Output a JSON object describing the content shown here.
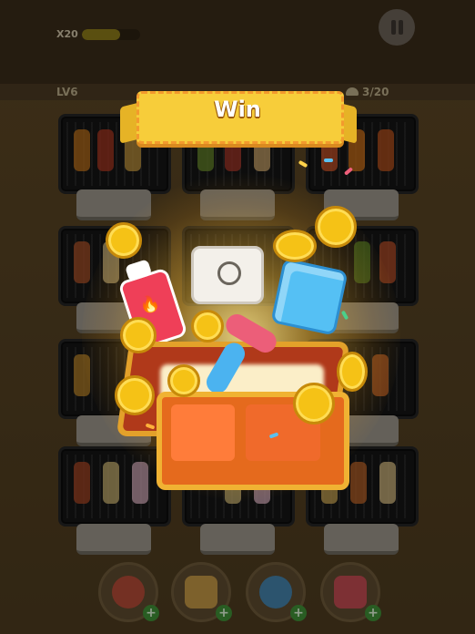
{
  "header": {
    "multiplier": "X20",
    "coin_progress": 0.65,
    "level": "LV6",
    "orders_progress": "3/20"
  },
  "banner": {
    "title": "Win"
  },
  "reward": {
    "items": [
      "takeout-box",
      "ice-cube",
      "fire-spray",
      "swap-arrows",
      "gold-coins"
    ]
  },
  "toolbar": {
    "tools": [
      {
        "name": "shuffle-tool",
        "icon": "refresh-arrows-icon",
        "plus": "+"
      },
      {
        "name": "bag-tool",
        "icon": "takeaway-bag-icon",
        "plus": "+"
      },
      {
        "name": "freeze-tool",
        "icon": "snowflake-icon",
        "plus": "+"
      },
      {
        "name": "spray-tool",
        "icon": "fire-spray-icon",
        "plus": "+"
      }
    ]
  },
  "colors": {
    "banner_yellow": "#f7cd3a",
    "chest_orange": "#e56a1d",
    "coin_gold": "#f5c216",
    "ice_blue": "#55c0f4"
  }
}
